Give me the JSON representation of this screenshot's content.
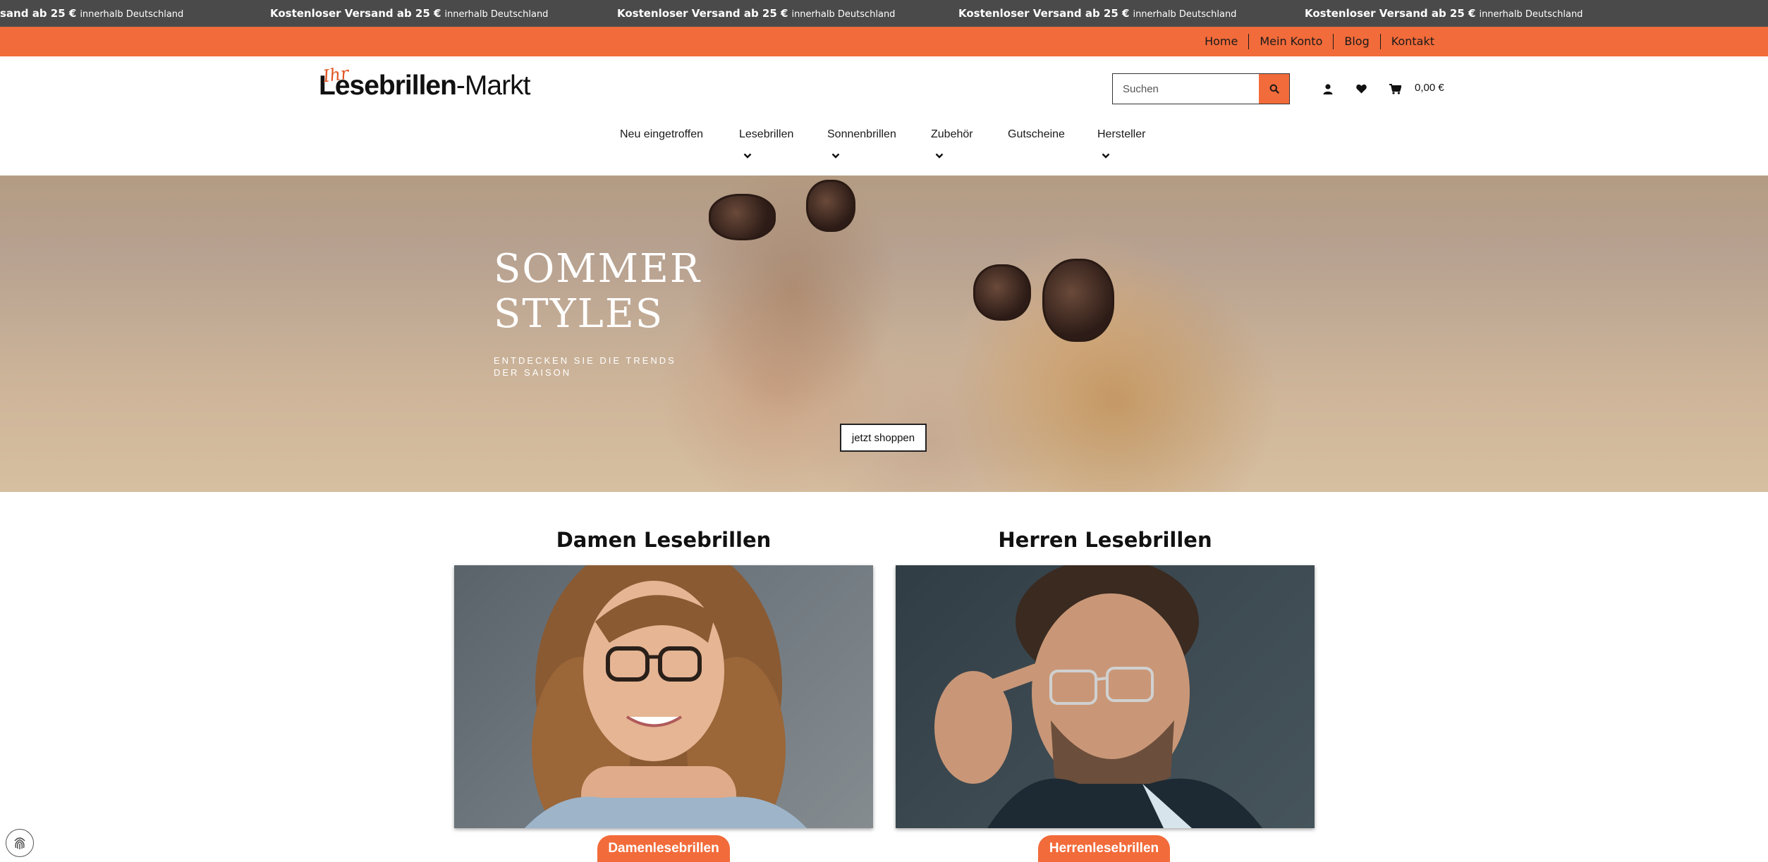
{
  "announcement": {
    "items": [
      {
        "bold": "sand ab 25 €",
        "small": "innerhalb Deutschland"
      },
      {
        "bold": "Kostenloser Versand ab 25 €",
        "small": "innerhalb Deutschland"
      },
      {
        "bold": "Kostenloser Versand ab 25 €",
        "small": "innerhalb Deutschland"
      },
      {
        "bold": "Kostenloser Versand ab 25 €",
        "small": "innerhalb Deutschland"
      },
      {
        "bold": "Kostenloser Versand ab 25 €",
        "small": "innerhalb Deutschland"
      }
    ]
  },
  "topnav": {
    "links": [
      "Home",
      "Mein Konto",
      "Blog",
      "Kontakt"
    ]
  },
  "header": {
    "logo": {
      "script": "Ihr",
      "bold": "Lesebrillen",
      "light": "-Markt"
    },
    "search": {
      "placeholder": "Suchen",
      "button_icon": "search-icon"
    },
    "icons": [
      "user-icon",
      "heart-icon",
      "cart-icon"
    ],
    "cart_amount": "0,00 €"
  },
  "mainnav": {
    "items": [
      {
        "label": "Neu eingetroffen",
        "has_dropdown": false
      },
      {
        "label": "Lesebrillen",
        "has_dropdown": true
      },
      {
        "label": "Sonnenbrillen",
        "has_dropdown": true
      },
      {
        "label": "Zubehör",
        "has_dropdown": true
      },
      {
        "label": "Gutscheine",
        "has_dropdown": false
      },
      {
        "label": "Hersteller",
        "has_dropdown": true
      }
    ]
  },
  "hero": {
    "title_line1": "SOMMER",
    "title_line2": "STYLES",
    "subtitle_line1": "ENTDECKEN SIE DIE TRENDS",
    "subtitle_line2": "DER SAISON",
    "cta": "jetzt shoppen"
  },
  "categories": [
    {
      "title": "Damen Lesebrillen",
      "button": "Damenlesebrillen"
    },
    {
      "title": "Herren Lesebrillen",
      "button": "Herrenlesebrillen"
    }
  ],
  "colors": {
    "accent": "#f26b3a",
    "announcement_bg": "#4a4a4a"
  },
  "misc": {
    "cookie_icon": "fingerprint-icon"
  }
}
